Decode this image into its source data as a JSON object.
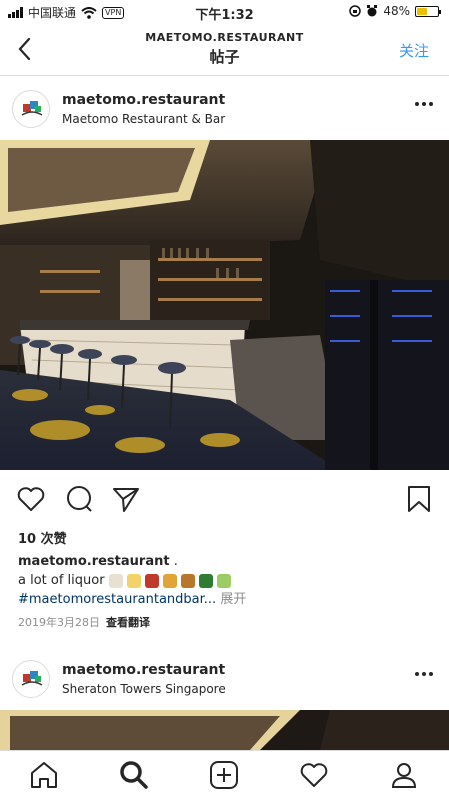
{
  "status_bar": {
    "carrier": "中国联通",
    "vpn": "VPN",
    "time": "下午1:32",
    "battery": "48%"
  },
  "header": {
    "subtitle": "MAETOMO.RESTAURANT",
    "title": "帖子",
    "follow": "关注"
  },
  "post": {
    "username": "maetomo.restaurant",
    "location": "Maetomo Restaurant & Bar",
    "likes": "10 次赞",
    "caption_user": "maetomo.restaurant",
    "caption_after_user": " .",
    "caption_text": "a lot of liquor",
    "hashtag": "#maetomorestaurantandbar...",
    "more_label": "展开",
    "date": "2019年3月28日",
    "translate": "查看翻译"
  },
  "next_post": {
    "username": "maetomo.restaurant",
    "location": "Sheraton Towers Singapore"
  },
  "icons": {
    "like": "heart-icon",
    "comment": "comment-icon",
    "share": "send-icon",
    "save": "bookmark-icon",
    "home": "home-icon",
    "search": "search-icon",
    "add": "add-post-icon",
    "activity": "heart-icon",
    "profile": "profile-icon"
  },
  "colors": {
    "link_blue": "#3897f0",
    "hashtag": "#003569",
    "muted": "#8e8e8e"
  }
}
